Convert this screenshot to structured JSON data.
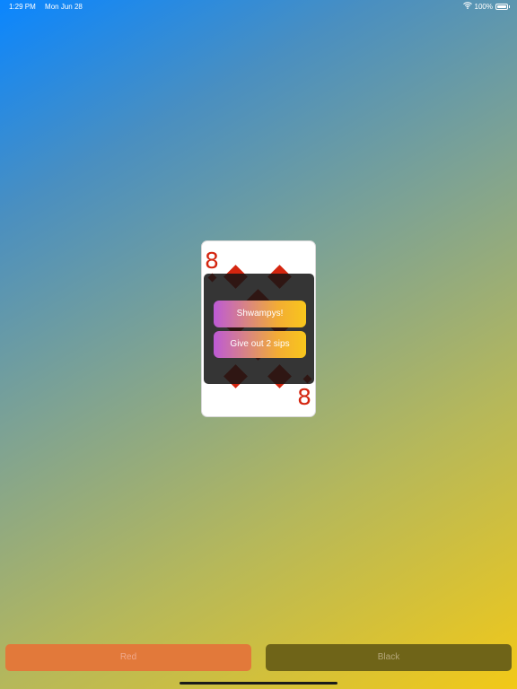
{
  "status_bar": {
    "time": "1:29 PM",
    "date": "Mon Jun 28",
    "battery_percent": "100%",
    "wifi_icon": "wifi-icon",
    "battery_icon": "battery-icon",
    "battery_level": 1.0
  },
  "card": {
    "rank": "8",
    "suit": "diamonds",
    "suit_color": "#d4250f"
  },
  "overlay": {
    "primary_label": "Shwampys!",
    "secondary_label": "Give out 2 sips"
  },
  "buttons": {
    "red_label": "Red",
    "black_label": "Black"
  },
  "colors": {
    "background_start": "#0a86ff",
    "background_end": "#f2c918",
    "red_button": "#e2793a",
    "black_button": "#6f6418",
    "accent_gradient_start": "#bd5ad6",
    "accent_gradient_end": "#f8c61c"
  }
}
